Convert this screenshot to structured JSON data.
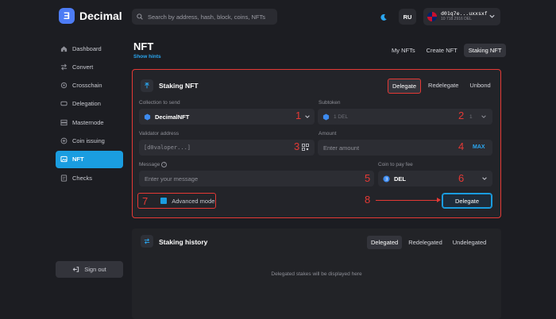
{
  "header": {
    "brand": "Decimal",
    "search_placeholder": "Search by address, hash, block, coins, NFTs",
    "lang": "RU",
    "account_address": "d01q7e...uxxsxf",
    "account_balance": "10 718.2916 DEL"
  },
  "sidebar": {
    "items": [
      {
        "label": "Dashboard",
        "icon": "home-icon"
      },
      {
        "label": "Convert",
        "icon": "convert-icon"
      },
      {
        "label": "Crosschain",
        "icon": "crosschain-icon"
      },
      {
        "label": "Delegation",
        "icon": "delegation-icon"
      },
      {
        "label": "Masternode",
        "icon": "masternode-icon"
      },
      {
        "label": "Coin issuing",
        "icon": "coin-icon"
      },
      {
        "label": "NFT",
        "icon": "image-icon"
      },
      {
        "label": "Checks",
        "icon": "checks-icon"
      }
    ],
    "signout": "Sign out"
  },
  "page": {
    "title": "NFT",
    "hints": "Show hints",
    "tabs": [
      "My NFTs",
      "Create NFT",
      "Staking NFT"
    ]
  },
  "staking": {
    "title": "Staking NFT",
    "tabs": [
      "Delegate",
      "Redelegate",
      "Unbond"
    ],
    "collection_label": "Collection to send",
    "collection_value": "DecimalNFT",
    "subtoken_label": "Subtoken",
    "subtoken_value": "1 DEL",
    "subtoken_count": "1",
    "validator_label": "Validator address",
    "validator_value": "[d0valoper...]",
    "amount_label": "Amount",
    "amount_placeholder": "Enter amount",
    "max": "MAX",
    "message_label": "Message",
    "message_placeholder": "Enter your message",
    "fee_label": "Coin to pay fee",
    "fee_value": "DEL",
    "advanced": "Advanced mode",
    "submit": "Delegate"
  },
  "annotations": [
    "1",
    "2",
    "3",
    "4",
    "5",
    "6",
    "7",
    "8"
  ],
  "history": {
    "title": "Staking history",
    "tabs": [
      "Delegated",
      "Redelegated",
      "Undelegated"
    ],
    "empty": "Delegated stakes will be displayed here"
  },
  "colors": {
    "accent": "#1a9de0",
    "annotation": "#e53935",
    "background": "#1c1d22"
  }
}
